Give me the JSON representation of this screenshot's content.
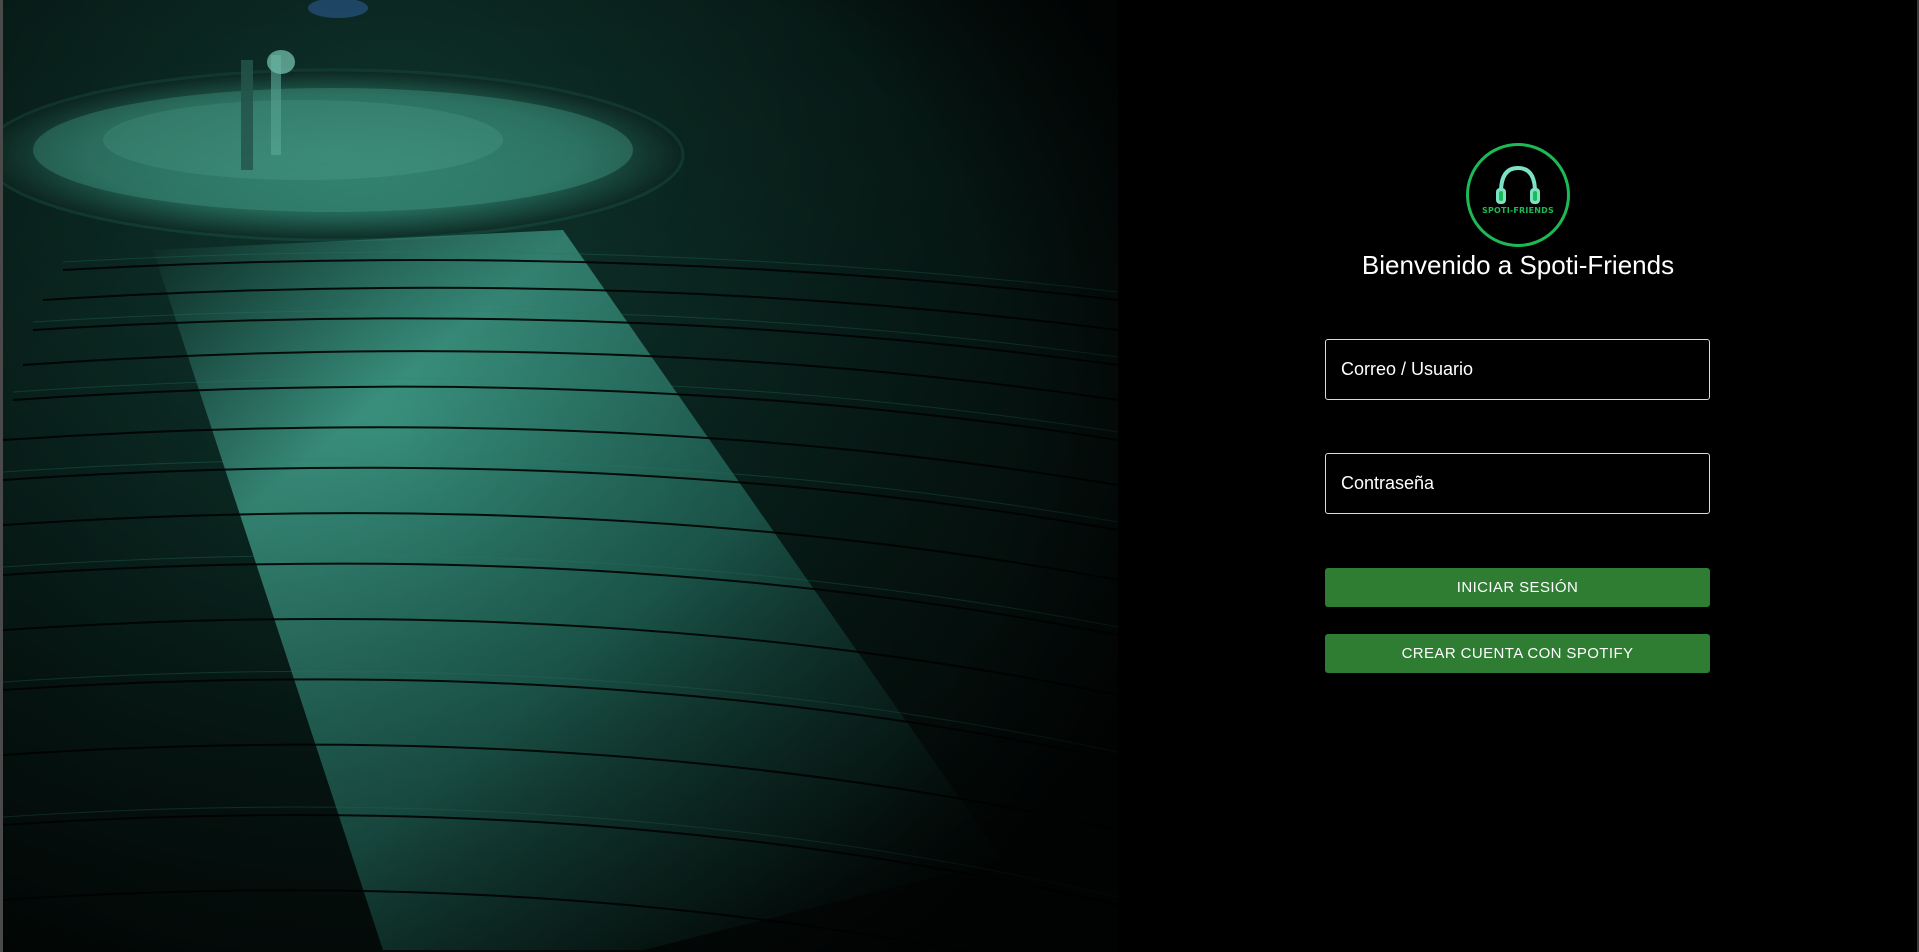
{
  "app": {
    "welcome_title": "Bienvenido a Spoti-Friends",
    "logo_text": "SPOTI-FRIENDS"
  },
  "login_form": {
    "email_placeholder": "Correo / Usuario",
    "password_placeholder": "Contraseña",
    "login_button": "INICIAR SESIÓN",
    "spotify_button": "CREAR CUENTA CON SPOTIFY"
  },
  "icons": {
    "logo": "headphones-icon"
  },
  "colors": {
    "background": "#000000",
    "accent_green": "#1db954",
    "button_green": "#2e7d32",
    "field_border": "#d9d9d9",
    "text": "#ffffff"
  }
}
